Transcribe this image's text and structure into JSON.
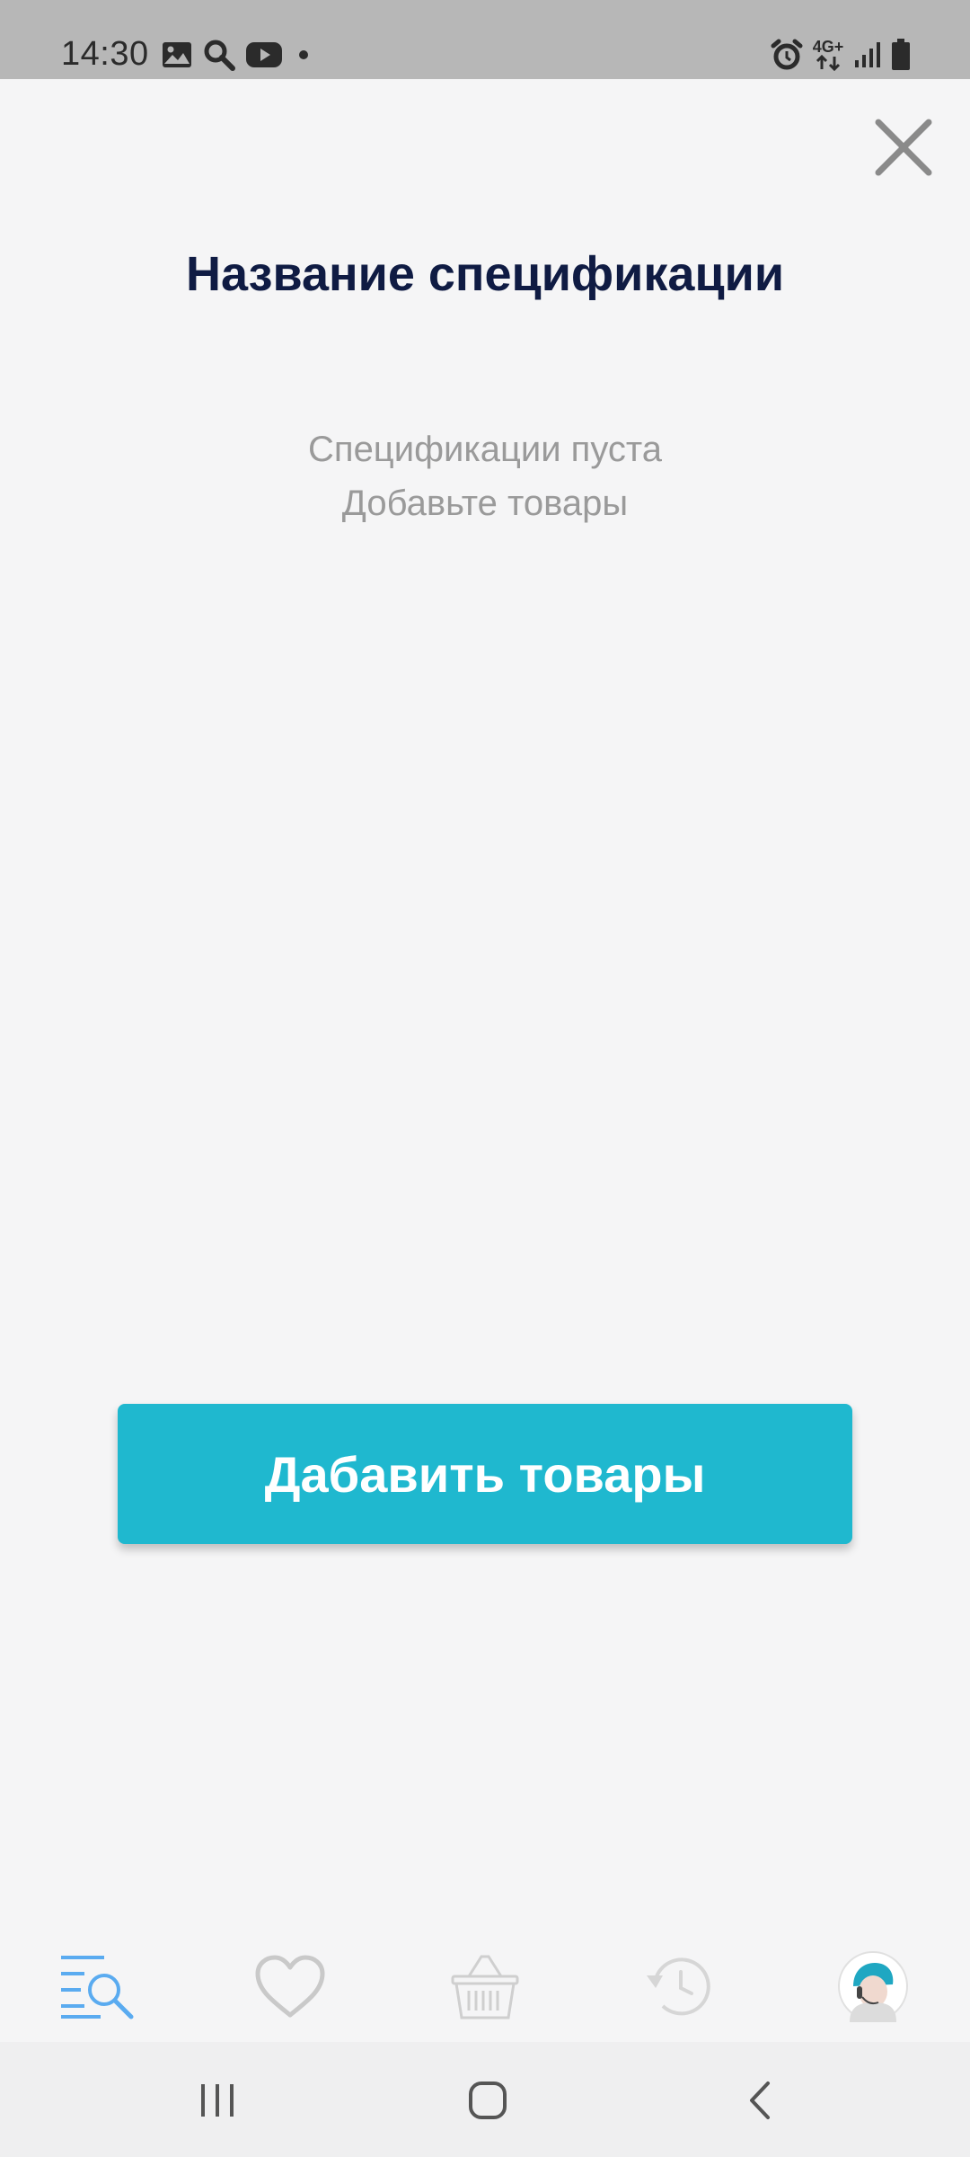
{
  "status_bar": {
    "time": "14:30",
    "network_label": "4G+",
    "left_icons": [
      "gallery-icon",
      "search-icon",
      "youtube-icon",
      "dot-icon"
    ],
    "right_icons": [
      "alarm-icon",
      "network-icon",
      "signal-icon",
      "battery-icon"
    ]
  },
  "header": {
    "title": "Название спецификации",
    "close_icon": "close-icon"
  },
  "empty_state": {
    "line1": "Спецификации пуста",
    "line2": "Добавьте товары"
  },
  "primary_action": {
    "label": "Дабавить товары",
    "color": "#1fb8cf"
  },
  "tab_bar": {
    "active_color": "#5aabf0",
    "inactive_color": "#c9c9c9",
    "tabs": [
      {
        "icon": "catalog-search-icon",
        "active": true
      },
      {
        "icon": "heart-icon",
        "active": false
      },
      {
        "icon": "basket-icon",
        "active": false
      },
      {
        "icon": "history-icon",
        "active": false
      },
      {
        "icon": "avatar-icon",
        "active": false
      }
    ]
  },
  "nav_bar": {
    "buttons": [
      "recent-apps-icon",
      "home-icon",
      "back-icon"
    ]
  },
  "colors": {
    "title": "#0f1b43",
    "muted_text": "#9a9a9a",
    "background": "#f5f5f6"
  }
}
